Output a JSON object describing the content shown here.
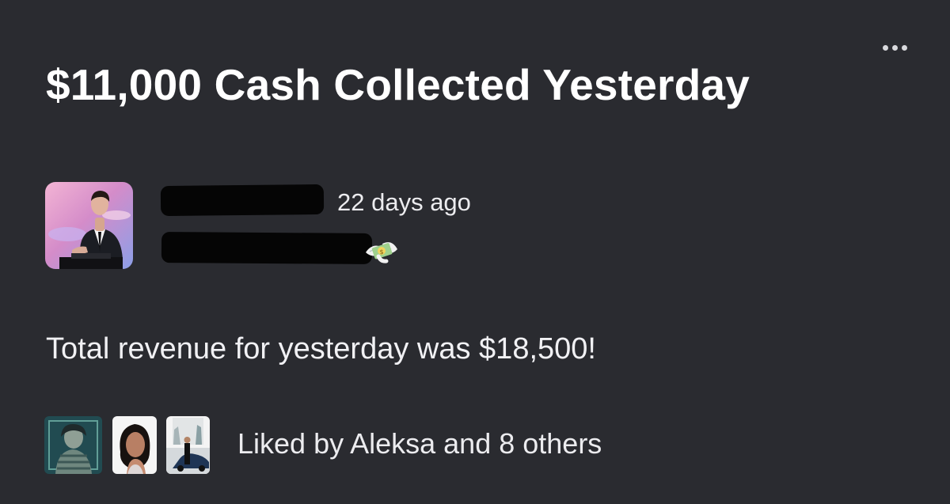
{
  "post": {
    "title": "$11,000 Cash Collected Yesterday",
    "more_icon": "more-horizontal-icon",
    "author": {
      "avatar_icon": "author-avatar",
      "timestamp": "22 days ago",
      "badge_icon": "money-with-wings-icon"
    },
    "body": "Total revenue for yesterday was $18,500!",
    "likes": {
      "text": "Liked by Aleksa and 8 others",
      "avatars": [
        "liker-avatar",
        "liker-avatar",
        "liker-avatar"
      ]
    }
  },
  "colors": {
    "background": "#2a2b30",
    "text": "#f4f4f6",
    "secondary_text": "#ececef",
    "redaction": "#050505"
  }
}
